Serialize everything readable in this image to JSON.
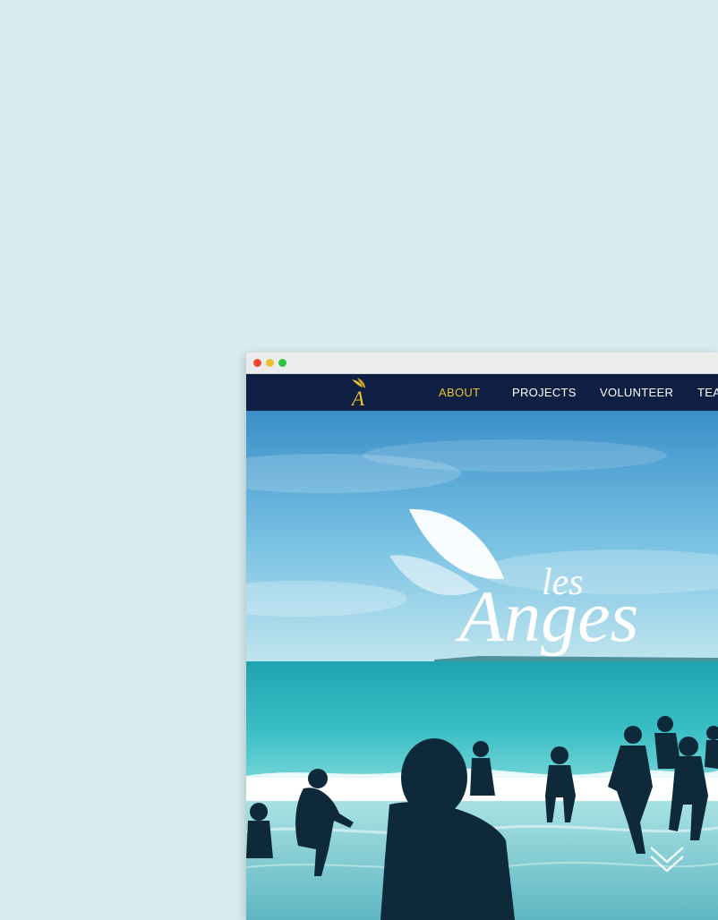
{
  "browser": {
    "window_controls": [
      "close-dot",
      "minimize-dot",
      "maximize-dot"
    ]
  },
  "nav": {
    "logo_letter": "A",
    "items": [
      {
        "label": "ABOUT",
        "active": true
      },
      {
        "label": "PROJECTS",
        "active": false
      },
      {
        "label": "VOLUNTEER",
        "active": false
      },
      {
        "label": "TEA",
        "active": false
      }
    ]
  },
  "hero": {
    "title_small": "les",
    "title_large": "Anges"
  },
  "colors": {
    "page_background": "#d8edf0",
    "nav_background": "#0f1f44",
    "nav_active": "#e9c332",
    "nav_text": "#ffffff",
    "sea": "#3bbfc6",
    "sky": "#3a9fd2"
  },
  "icons": {
    "logo": "winged-letter-logo-icon",
    "scroll": "double-chevron-down-icon",
    "hero_mark": "wing-leaf-icon"
  }
}
